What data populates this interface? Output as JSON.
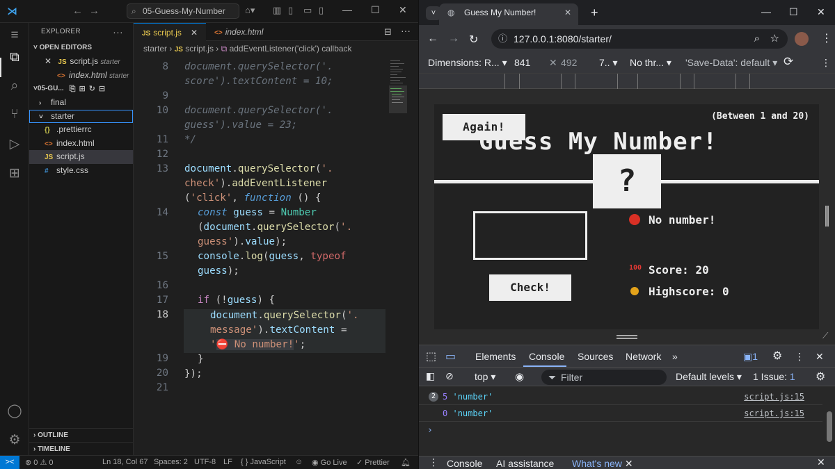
{
  "vscode": {
    "search": "05-Guess-My-Number",
    "sidebar": {
      "explorer_label": "EXPLORER",
      "open_editors_label": "OPEN EDITORS",
      "open_editors": [
        {
          "name": "script.js",
          "folder": "starter",
          "icon": "JS"
        },
        {
          "name": "index.html",
          "folder": "starter",
          "icon": "<>"
        }
      ],
      "folder_label": "05-GU...",
      "tree": [
        {
          "name": "final",
          "icon": ">"
        },
        {
          "name": "starter",
          "icon": "v"
        },
        {
          "name": ".prettierrc",
          "icon": "{}"
        },
        {
          "name": "index.html",
          "icon": "<>"
        },
        {
          "name": "script.js",
          "icon": "JS"
        },
        {
          "name": "style.css",
          "icon": "#"
        }
      ],
      "outline_label": "OUTLINE",
      "timeline_label": "TIMELINE"
    },
    "tabs": [
      {
        "label": "script.js",
        "icon": "JS"
      },
      {
        "label": "index.html",
        "icon": "<>"
      }
    ],
    "breadcrumb": {
      "folder": "starter",
      "file": "script.js",
      "symbol": "addEventListener('click') callback"
    },
    "line_numbers": [
      "8",
      "",
      "9",
      "10",
      "",
      "11",
      "12",
      "13",
      "",
      "",
      "14",
      "",
      "",
      "15",
      "",
      "16",
      "17",
      "18",
      "",
      "",
      "19",
      "20",
      "21"
    ],
    "status": {
      "remote": "><",
      "problems": "⊗ 0  ⚠ 0",
      "position": "Ln 18, Col 67",
      "spaces": "Spaces: 2",
      "encoding": "UTF-8",
      "eol": "LF",
      "language": "{ }  JavaScript",
      "golive": "Go Live",
      "prettier": "✓ Prettier"
    }
  },
  "browser": {
    "tab_title": "Guess My Number!",
    "url": "127.0.0.1:8080/starter/",
    "devbar": {
      "dimensions": "Dimensions: R...",
      "width": "841",
      "height": "492",
      "zoom": "7..",
      "throttle": "No thr...",
      "save_data": "'Save-Data': default"
    },
    "game": {
      "again": "Again!",
      "between": "(Between 1 and 20)",
      "title": "Guess My Number!",
      "number": "?",
      "check": "Check!",
      "message": "No number!",
      "score_label": "Score:",
      "score": "20",
      "highscore_label": "Highscore:",
      "highscore": "0"
    },
    "devtools": {
      "tabs": [
        "Elements",
        "Console",
        "Sources",
        "Network"
      ],
      "issue_count": "1",
      "context": "top",
      "filter_placeholder": "Filter",
      "levels": "Default levels",
      "issues": "1 Issue:",
      "issues_count": "1",
      "logs": [
        {
          "count": "2",
          "value": "5",
          "type": "'number'",
          "source": "script.js:15"
        },
        {
          "count": "",
          "value": "0",
          "type": "'number'",
          "source": "script.js:15"
        }
      ],
      "drawer_tabs": [
        "Console",
        "AI assistance",
        "What's new"
      ]
    }
  }
}
